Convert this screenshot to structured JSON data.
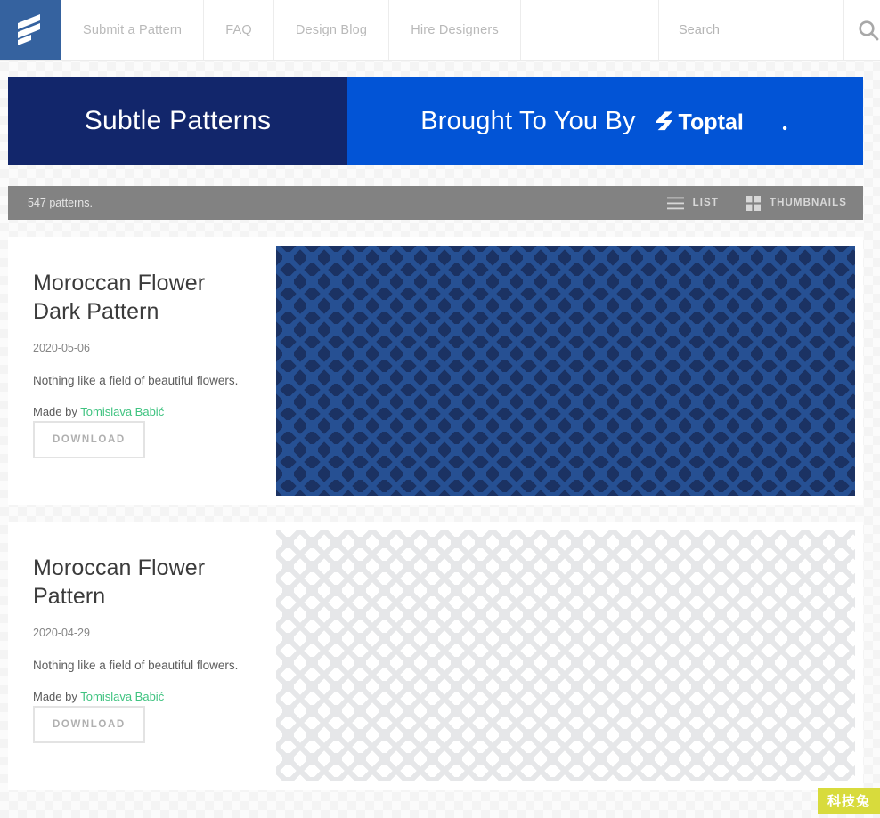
{
  "header": {
    "logo_name": "subtle-patterns-logo",
    "logo_color": "#35629f",
    "nav": [
      {
        "label": "Submit a Pattern",
        "name": "nav-submit-a-pattern"
      },
      {
        "label": "FAQ",
        "name": "nav-faq"
      },
      {
        "label": "Design Blog",
        "name": "nav-design-blog"
      },
      {
        "label": "Hire Designers",
        "name": "nav-hire-designers"
      }
    ],
    "search": {
      "placeholder": "Search",
      "value": "",
      "icon": "search-icon"
    }
  },
  "banner": {
    "left_text": "Subtle Patterns",
    "left_color": "#12266b",
    "right_text": "Brought To You By",
    "right_color": "#0254d6",
    "sponsor": "Toptal"
  },
  "toolbar": {
    "count_text": "547 patterns.",
    "bar_color": "#828282",
    "views": [
      {
        "label": "LIST",
        "icon": "list-icon",
        "name": "view-toggle-list"
      },
      {
        "label": "THUMBNAILS",
        "icon": "grid-icon",
        "name": "view-toggle-thumbnails"
      }
    ]
  },
  "patterns": [
    {
      "title": "Moroccan Flower Dark Pattern",
      "date": "2020-05-06",
      "description": "Nothing like a field of beautiful flowers.",
      "made_by_label": "Made by",
      "author": "Tomislava Babić",
      "download_label": "DOWNLOAD",
      "swatch_style": "swatch-dark",
      "swatch_bg": "#1b3263",
      "swatch_fg": "#265093"
    },
    {
      "title": "Moroccan Flower Pattern",
      "date": "2020-04-29",
      "description": "Nothing like a field of beautiful flowers.",
      "made_by_label": "Made by",
      "author": "Tomislava Babić",
      "download_label": "DOWNLOAD",
      "swatch_style": "swatch-light",
      "swatch_bg": "#ffffff",
      "swatch_fg": "#e6e7e9"
    }
  ],
  "watermark": {
    "text": "科技兔",
    "bg_color": "#d8db3c"
  },
  "link_color": "#3fc380"
}
